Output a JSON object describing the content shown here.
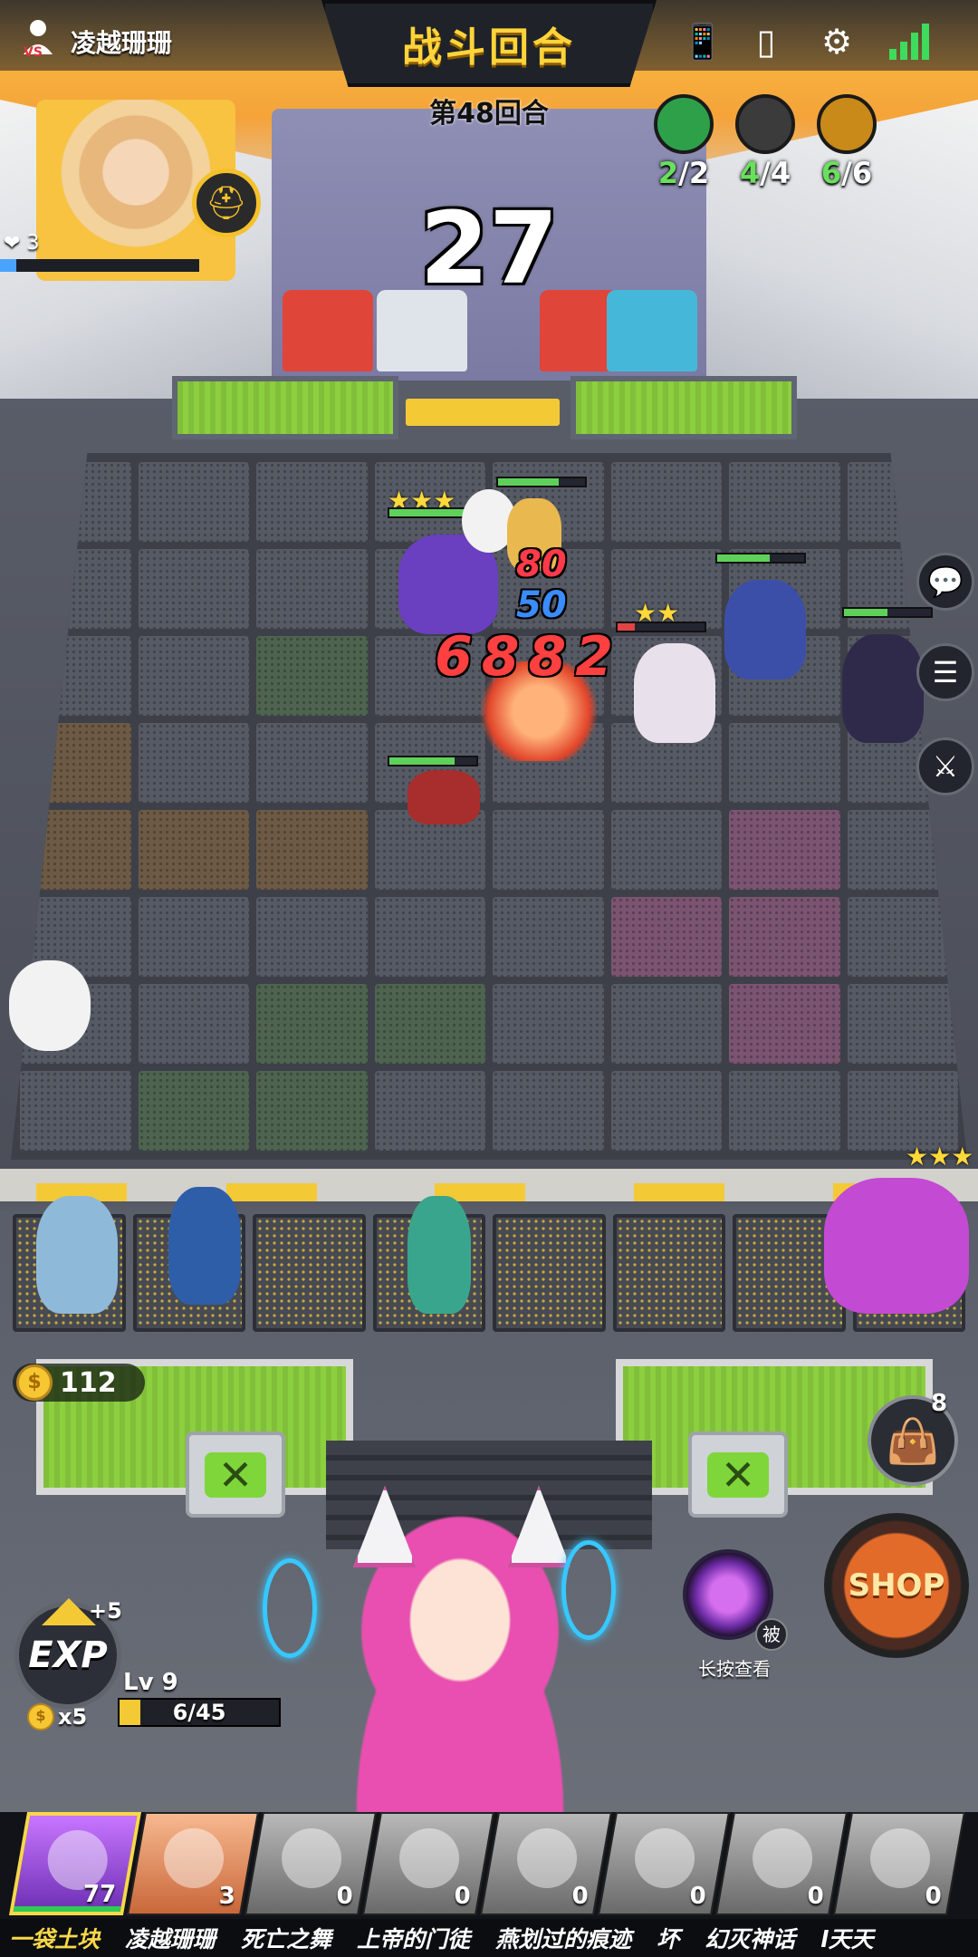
{
  "header": {
    "player_name": "凌越珊珊",
    "title": "战斗回合",
    "round": "第48回合",
    "timer": "27"
  },
  "synergies": [
    {
      "name": "leaf-trait",
      "count": "2",
      "max": "/2",
      "color": "#2fa04a"
    },
    {
      "name": "eye-trait",
      "count": "4",
      "max": "/4",
      "color": "#3b3b3b"
    },
    {
      "name": "hood-trait",
      "count": "6",
      "max": "/6",
      "color": "#c98a1a"
    }
  ],
  "opponent": {
    "lives": "3",
    "hp_fraction": 0.08
  },
  "battle": {
    "damage_numbers": [
      "80",
      "50",
      "6882"
    ],
    "star_ratings": [
      "★★★",
      "★★",
      "★★★"
    ]
  },
  "hud": {
    "gold": "112",
    "bag_count": "8",
    "shop_label": "SHOP",
    "skill_tag": "被",
    "skill_hint": "长按查看",
    "exp_label": "EXP",
    "exp_gain": "+5",
    "exp_cost": "x5",
    "level": "Lv 9",
    "xp": "6/45",
    "xp_fraction": 0.133
  },
  "players": [
    {
      "name": "一袋土块",
      "hp": "77",
      "self": true
    },
    {
      "name": "凌越珊珊",
      "hp": "3",
      "active": true
    },
    {
      "name": "死亡之舞",
      "hp": "0"
    },
    {
      "name": "上帝的门徒",
      "hp": "0"
    },
    {
      "name": "燕划过的痕迹",
      "hp": "0"
    },
    {
      "name": "坏",
      "hp": "0"
    },
    {
      "name": "幻灭神话",
      "hp": "0"
    },
    {
      "name": "l天天",
      "hp": "0"
    }
  ],
  "icons": {
    "vs": "vs-icon",
    "phone_rotate": "phone-rotate-icon",
    "book": "book-icon",
    "gear": "gear-icon",
    "signal": "signal-icon",
    "chat": "chat-icon",
    "players_list": "player-list-icon",
    "battle_log": "sword-icon",
    "skull": "skull-icon",
    "bag": "bag-icon"
  }
}
